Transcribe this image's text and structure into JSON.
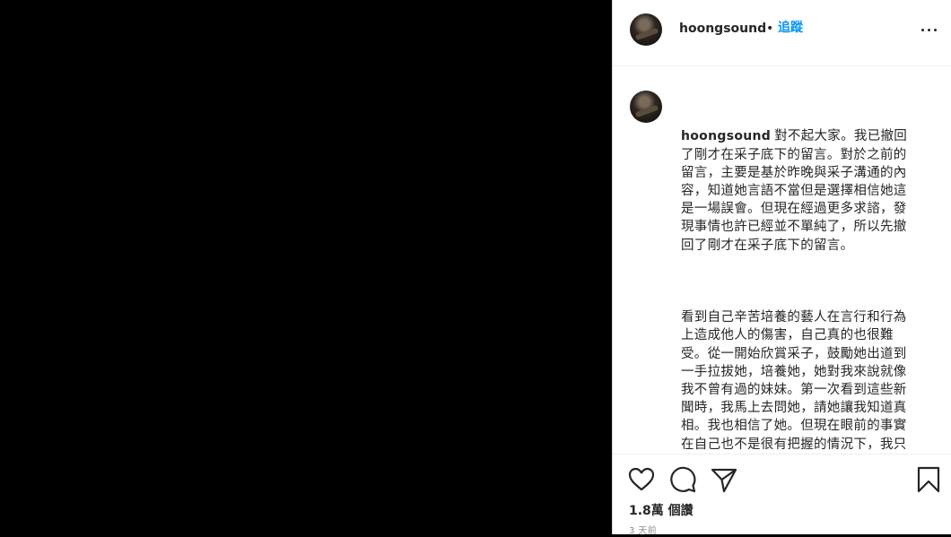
{
  "post": {
    "username": "hoongsound",
    "separator": "•",
    "follow_label": "追蹤",
    "caption_username": "hoongsound",
    "caption_p1": "對不起大家。我已撤回了剛才在采子底下的留言。對於之前的留言，主要是基於昨晚與采子溝通的內容，知道她言語不當但是選擇相信她這是一場誤會。但現在經過更多求諮，發現事情也許已經並不單純了，所以先撤回了剛才在采子底下的留言。",
    "caption_p2": "看到自己辛苦培養的藝人在言行和行為上造成他人的傷害，自己真的也很難受。從一開始欣賞采子，鼓勵她出道到一手拉拔她，培養她，她對我來說就像我不曾有過的妹妹。第一次看到這些新聞時，我馬上去問她，請她讓我知道真相。我也相信了她。但現在眼前的事實在自己也不是很有把握的情況下，我只能說對采子的行為感到失望。 希望她能夠吸取這次的教訓，做個對生活更有責任心的大人。",
    "views": "1.8萬 個讚",
    "time": "3 天前"
  },
  "icons": {
    "more": "more-options-icon",
    "like": "heart-icon",
    "comment": "comment-bubble-icon",
    "share": "send-icon",
    "save": "bookmark-icon"
  },
  "colors": {
    "accent": "#0095f6",
    "text": "#262626",
    "muted": "#8e8e8e",
    "border": "#dbdbdb"
  }
}
